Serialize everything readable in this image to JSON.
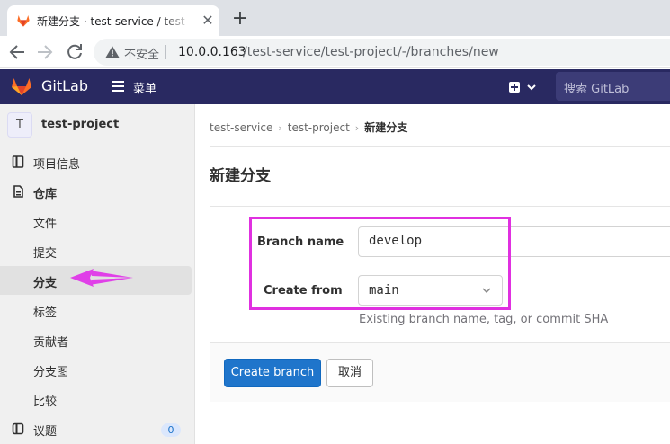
{
  "browser": {
    "tab_title": "新建分支 · test-service / test-project",
    "tab_close": "✕",
    "new_tab": "+",
    "back_icon": "arrow-left",
    "forward_icon": "arrow-right",
    "reload_icon": "reload",
    "insecure_label": "不安全",
    "url_host": "10.0.0.163",
    "url_path": "/test-service/test-project/-/branches/new"
  },
  "header": {
    "app_name": "GitLab",
    "menu_label": "菜单",
    "search_placeholder": "搜索 GitLab",
    "brand_color": "#292961"
  },
  "sidebar": {
    "project_avatar": "T",
    "project_name": "test-project",
    "items": [
      {
        "label": "项目信息",
        "icon": "project-icon"
      },
      {
        "label": "仓库",
        "icon": "repository-icon"
      },
      {
        "label": "文件"
      },
      {
        "label": "提交"
      },
      {
        "label": "分支",
        "active": true
      },
      {
        "label": "标签"
      },
      {
        "label": "贡献者"
      },
      {
        "label": "分支图"
      },
      {
        "label": "比较"
      },
      {
        "label": "议题",
        "icon": "issues-icon",
        "badge": "0"
      }
    ]
  },
  "breadcrumb": {
    "items": [
      "test-service",
      "test-project",
      "新建分支"
    ]
  },
  "page": {
    "title": "新建分支"
  },
  "form": {
    "branch_name_label": "Branch name",
    "branch_name_value": "develop",
    "create_from_label": "Create from",
    "create_from_value": "main",
    "help_text": "Existing branch name, tag, or commit SHA",
    "submit_label": "Create branch",
    "cancel_label": "取消",
    "accent_color": "#1f75cb",
    "highlight_color": "#e030e0"
  }
}
